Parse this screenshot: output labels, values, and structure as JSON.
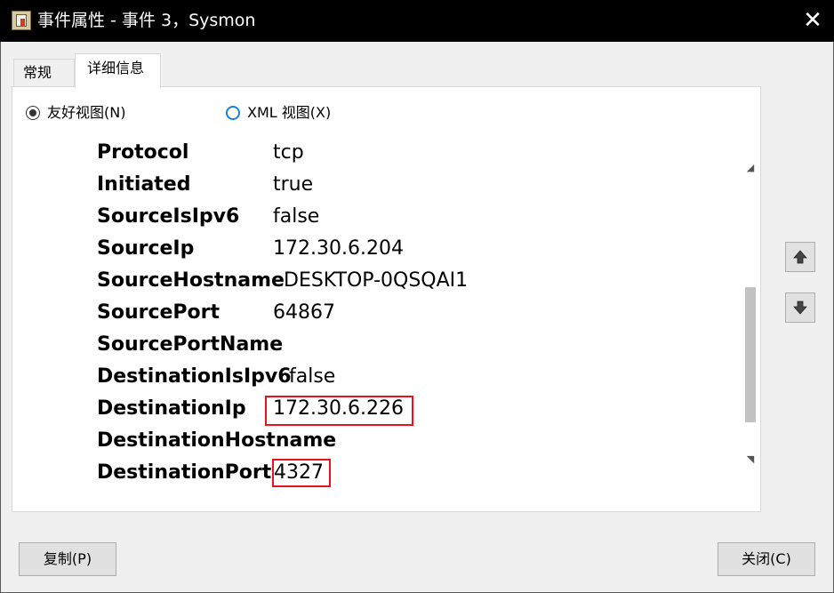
{
  "window": {
    "title": "事件属性 - 事件 3，Sysmon",
    "app_icon": "event-viewer-icon",
    "close_glyph": "✕"
  },
  "tabs": [
    {
      "label": "常规",
      "selected": false
    },
    {
      "label": "详细信息",
      "selected": true
    }
  ],
  "view_mode": {
    "friendly_label": "友好视图(N)",
    "xml_label": "XML 视图(X)",
    "selected": "friendly"
  },
  "event_data": [
    {
      "key": "Protocol",
      "value": "tcp"
    },
    {
      "key": "Initiated",
      "value": "true"
    },
    {
      "key": "SourceIsIpv6",
      "value": "false"
    },
    {
      "key": "SourceIp",
      "value": "172.30.6.204"
    },
    {
      "key": "SourceHostname",
      "value": "DESKTOP-0QSQAI1"
    },
    {
      "key": "SourcePort",
      "value": "64867"
    },
    {
      "key": "SourcePortName",
      "value": ""
    },
    {
      "key": "DestinationIsIpv6",
      "value": "false"
    },
    {
      "key": "DestinationIp",
      "value": "172.30.6.226"
    },
    {
      "key": "DestinationHostname",
      "value": ""
    },
    {
      "key": "DestinationPort",
      "value": "4327"
    }
  ],
  "highlighted_values": [
    "DestinationIp",
    "DestinationPort"
  ],
  "navigation": {
    "previous_icon": "arrow-up-icon",
    "next_icon": "arrow-down-icon"
  },
  "buttons": {
    "copy_label": "复制(P)",
    "close_label": "关闭(C)"
  },
  "colors": {
    "titlebar": "#000000",
    "highlight": "#e8141c",
    "radio_accent": "#1a7fd4"
  }
}
